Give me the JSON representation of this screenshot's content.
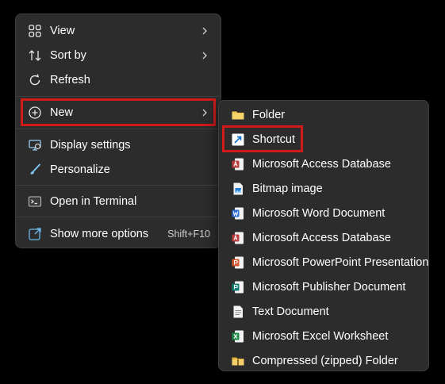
{
  "context_menu": {
    "items": [
      {
        "label": "View",
        "icon": "grid-icon",
        "submenu": true
      },
      {
        "label": "Sort by",
        "icon": "sort-icon",
        "submenu": true
      },
      {
        "label": "Refresh",
        "icon": "refresh-icon"
      },
      {
        "label": "New",
        "icon": "plus-circle-icon",
        "submenu": true,
        "highlighted": true
      },
      {
        "label": "Display settings",
        "icon": "display-icon"
      },
      {
        "label": "Personalize",
        "icon": "brush-icon"
      },
      {
        "label": "Open in Terminal",
        "icon": "terminal-icon"
      },
      {
        "label": "Show more options",
        "icon": "share-icon",
        "shortcut": "Shift+F10"
      }
    ]
  },
  "new_submenu": {
    "items": [
      {
        "label": "Folder",
        "icon": "folder-icon"
      },
      {
        "label": "Shortcut",
        "icon": "shortcut-icon",
        "highlighted": true
      },
      {
        "label": "Microsoft Access Database",
        "icon": "access-icon"
      },
      {
        "label": "Bitmap image",
        "icon": "bitmap-icon"
      },
      {
        "label": "Microsoft Word Document",
        "icon": "word-icon"
      },
      {
        "label": "Microsoft Access Database",
        "icon": "access-icon"
      },
      {
        "label": "Microsoft PowerPoint Presentation",
        "icon": "powerpoint-icon"
      },
      {
        "label": "Microsoft Publisher Document",
        "icon": "publisher-icon"
      },
      {
        "label": "Text Document",
        "icon": "text-document-icon"
      },
      {
        "label": "Microsoft Excel Worksheet",
        "icon": "excel-icon"
      },
      {
        "label": "Compressed (zipped) Folder",
        "icon": "zip-folder-icon"
      }
    ]
  },
  "colors": {
    "menu_bg": "#2c2c2c",
    "highlight_outline": "#d11a1a",
    "accent_blue": "#4cc2ff",
    "word": "#2b6cd6",
    "excel": "#1e8a4a",
    "powerpoint": "#d2572d",
    "publisher": "#0f7c72",
    "access": "#b83c3c",
    "folder": "#f2c14e"
  }
}
